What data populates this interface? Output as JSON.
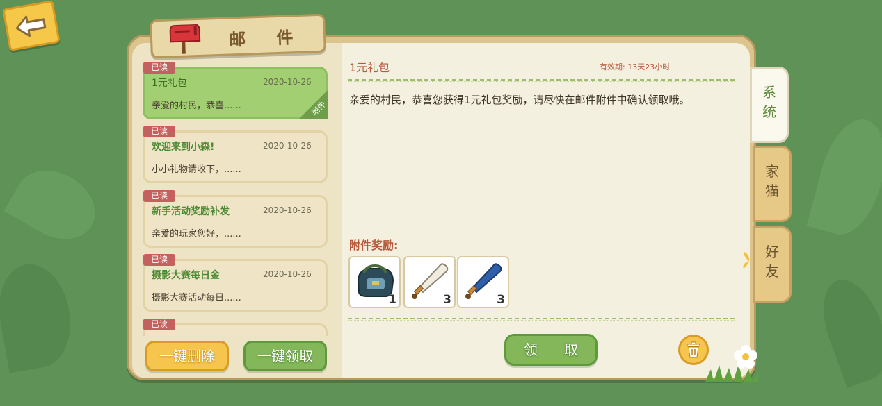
{
  "window": {
    "title": "邮 件"
  },
  "mail_list": [
    {
      "badge": "已读",
      "title": "1元礼包",
      "date": "2020-10-26",
      "preview": "亲爱的村民，恭喜......",
      "attachment_tag": "附件",
      "selected": true
    },
    {
      "badge": "已读",
      "title": "欢迎来到小森!",
      "date": "2020-10-26",
      "preview": "小小礼物请收下，......",
      "selected": false
    },
    {
      "badge": "已读",
      "title": "新手活动奖励补发",
      "date": "2020-10-26",
      "preview": "亲爱的玩家您好，......",
      "selected": false
    },
    {
      "badge": "已读",
      "title": "摄影大赛每日金",
      "date": "2020-10-26",
      "preview": "摄影大赛活动每日......",
      "selected": false
    },
    {
      "badge": "已读"
    }
  ],
  "buttons": {
    "delete_all": "一键删除",
    "claim_all": "一键领取",
    "claim": "领 取"
  },
  "detail": {
    "title": "1元礼包",
    "expiry_label": "有效期:",
    "expiry_value": "13天23小时",
    "body": "亲爱的村民，恭喜您获得1元礼包奖励，请尽快在邮件附件中确认领取哦。",
    "rewards_label": "附件奖励:",
    "rewards": [
      {
        "icon": "backpack-icon",
        "qty": "1"
      },
      {
        "icon": "baseball-bat-white-icon",
        "qty": "3"
      },
      {
        "icon": "baseball-bat-blue-icon",
        "qty": "3"
      }
    ]
  },
  "side_tabs": [
    {
      "c1": "系",
      "c2": "统",
      "active": true
    },
    {
      "c1": "家",
      "c2": "猫",
      "active": false
    },
    {
      "c1": "好",
      "c2": "友",
      "active": false
    }
  ],
  "colors": {
    "background": "#5e9256",
    "accent_green": "#83b75a",
    "accent_yellow": "#f6c54e",
    "heading_red": "#b75a3c"
  }
}
